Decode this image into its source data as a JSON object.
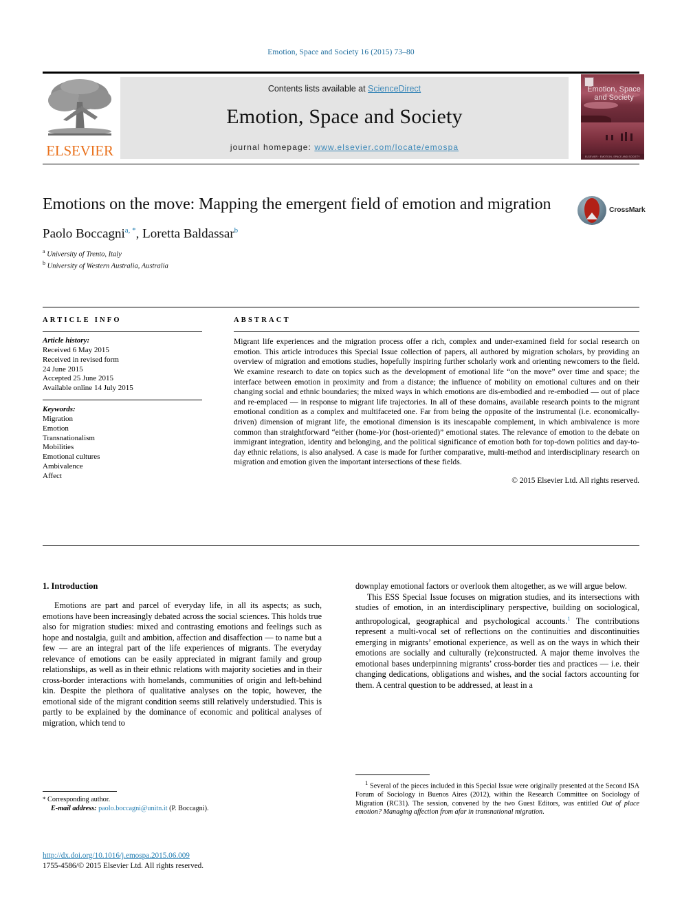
{
  "running_head": "Emotion, Space and Society 16 (2015) 73–80",
  "masthead": {
    "contents_prefix": "Contents lists available at ",
    "sciencedirect": "ScienceDirect",
    "journal_title": "Emotion, Space and Society",
    "homepage_prefix": "journal homepage: ",
    "homepage_url": "www.elsevier.com/locate/emospa",
    "publisher": "ELSEVIER",
    "cover_title": "Emotion, Space and Society",
    "cover_footer": "ELSEVIER  ·  EMOTION, SPACE AND SOCIETY  ·  VOL 16",
    "link_color": "#3c88b8",
    "band_color": "#e4e4e4",
    "publisher_color": "#E9711C",
    "cover_color": "#6e2230"
  },
  "title_block": {
    "title": "Emotions on the move: Mapping the emergent field of emotion and migration",
    "crossmark_label": "CrossMark",
    "authors": [
      {
        "name": "Paolo Boccagni",
        "marks": "a, *"
      },
      {
        "name": "Loretta Baldassar",
        "marks": "b"
      }
    ],
    "affiliations": [
      {
        "mark": "a",
        "text": "University of Trento, Italy"
      },
      {
        "mark": "b",
        "text": "University of Western Australia, Australia"
      }
    ]
  },
  "article_info": {
    "heading": "ARTICLE INFO",
    "history_label": "Article history:",
    "history": [
      "Received 6 May 2015",
      "Received in revised form",
      "24 June 2015",
      "Accepted 25 June 2015",
      "Available online 14 July 2015"
    ],
    "keywords_label": "Keywords:",
    "keywords": [
      "Migration",
      "Emotion",
      "Transnationalism",
      "Mobilities",
      "Emotional cultures",
      "Ambivalence",
      "Affect"
    ]
  },
  "abstract": {
    "heading": "ABSTRACT",
    "text": "Migrant life experiences and the migration process offer a rich, complex and under-examined field for social research on emotion. This article introduces this Special Issue collection of papers, all authored by migration scholars, by providing an overview of migration and emotions studies, hopefully inspiring further scholarly work and orienting newcomers to the field. We examine research to date on topics such as the development of emotional life “on the move” over time and space; the interface between emotion in proximity and from a distance; the influence of mobility on emotional cultures and on their changing social and ethnic boundaries; the mixed ways in which emotions are dis-embodied and re-embodied — out of place and re-emplaced — in response to migrant life trajectories. In all of these domains, available research points to the migrant emotional condition as a complex and multifaceted one. Far from being the opposite of the instrumental (i.e. economically-driven) dimension of migrant life, the emotional dimension is its inescapable complement, in which ambivalence is more common than straightforward “either (home-)/or (host-oriented)” emotional states. The relevance of emotion to the debate on immigrant integration, identity and belonging, and the political significance of emotion both for top-down politics and day-to-day ethnic relations, is also analysed. A case is made for further comparative, multi-method and interdisciplinary research on migration and emotion given the important intersections of these fields.",
    "copyright": "© 2015 Elsevier Ltd. All rights reserved."
  },
  "body": {
    "section_number_title": "1. Introduction",
    "left_paragraphs": [
      "Emotions are part and parcel of everyday life, in all its aspects; as such, emotions have been increasingly debated across the social sciences. This holds true also for migration studies: mixed and contrasting emotions and feelings such as hope and nostalgia, guilt and ambition, affection and disaffection — to name but a few — are an integral part of the life experiences of migrants. The everyday relevance of emotions can be easily appreciated in migrant family and group relationships, as well as in their ethnic relations with majority societies and in their cross-border interactions with homelands, communities of origin and left-behind kin. Despite the plethora of qualitative analyses on the topic, however, the emotional side of the migrant condition seems still relatively understudied. This is partly to be explained by the dominance of economic and political analyses of migration, which tend to"
    ],
    "right_paragraphs": [
      {
        "indent": false,
        "text": "downplay emotional factors or overlook them altogether, as we will argue below."
      },
      {
        "indent": true,
        "text_before_sup": "This ESS Special Issue focuses on migration studies, and its intersections with studies of emotion, in an interdisciplinary perspective, building on sociological, anthropological, geographical and psychological accounts.",
        "sup": "1",
        "text_after_sup": " The contributions represent a multi-vocal set of reflections on the continuities and discontinuities emerging in migrants’ emotional experience, as well as on the ways in which their emotions are socially and culturally (re)constructed. A major theme involves the emotional bases underpinning migrants’ cross-border ties and practices — i.e. their changing dedications, obligations and wishes, and the social factors accounting for them. A central question to be addressed, at least in a"
      }
    ]
  },
  "footnotes": {
    "left": {
      "star": "*",
      "corresponding": "Corresponding author.",
      "email_label": "E-mail address:",
      "email": "paolo.boccagni@unitn.it",
      "email_suffix": "(P. Boccagni)."
    },
    "right": {
      "marker": "1",
      "text_before_italic": "Several of the pieces included in this Special Issue were originally presented at the Second ISA Forum of Sociology in Buenos Aires (2012), within the Research Committee on Sociology of Migration (RC31). The session, convened by the two Guest Editors, was entitled ",
      "italic_title": "Out of place emotion? Managing affection from afar in transnational migration",
      "text_after_italic": "."
    }
  },
  "doi_block": {
    "doi_url": "http://dx.doi.org/10.1016/j.emospa.2015.06.009",
    "issn_line": "1755-4586/© 2015 Elsevier Ltd. All rights reserved."
  }
}
